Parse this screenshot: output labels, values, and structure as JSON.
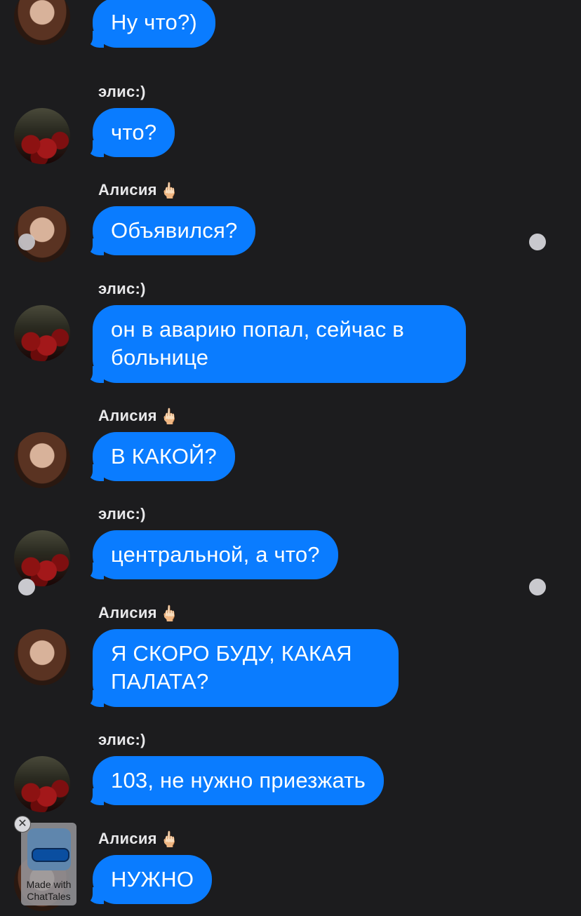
{
  "messages": [
    {
      "sender": "",
      "avatar": "girl",
      "text": "Ну что?)"
    },
    {
      "sender": "элис:)",
      "avatar": "roses",
      "text": "что?"
    },
    {
      "sender": "Алисия",
      "avatar": "girl",
      "text": "Объявился?"
    },
    {
      "sender": "элис:)",
      "avatar": "roses",
      "text": "он в аварию попал, сейчас в больнице"
    },
    {
      "sender": "Алисия",
      "avatar": "girl",
      "text": "В КАКОЙ?"
    },
    {
      "sender": "элис:)",
      "avatar": "roses",
      "text": "центральной, а что?"
    },
    {
      "sender": "Алисия",
      "avatar": "girl",
      "text": "Я СКОРО БУДУ, КАКАЯ ПАЛАТА?"
    },
    {
      "sender": "элис:)",
      "avatar": "roses",
      "text": "103, не нужно приезжать"
    },
    {
      "sender": "Алисия",
      "avatar": "girl",
      "text": "НУЖНО"
    }
  ],
  "sender_emoji": "🖕🏻",
  "watermark": {
    "close": "✕",
    "text": "Made with ChatTales"
  },
  "colors": {
    "background": "#1c1c1e",
    "bubble": "#0a7cff"
  }
}
